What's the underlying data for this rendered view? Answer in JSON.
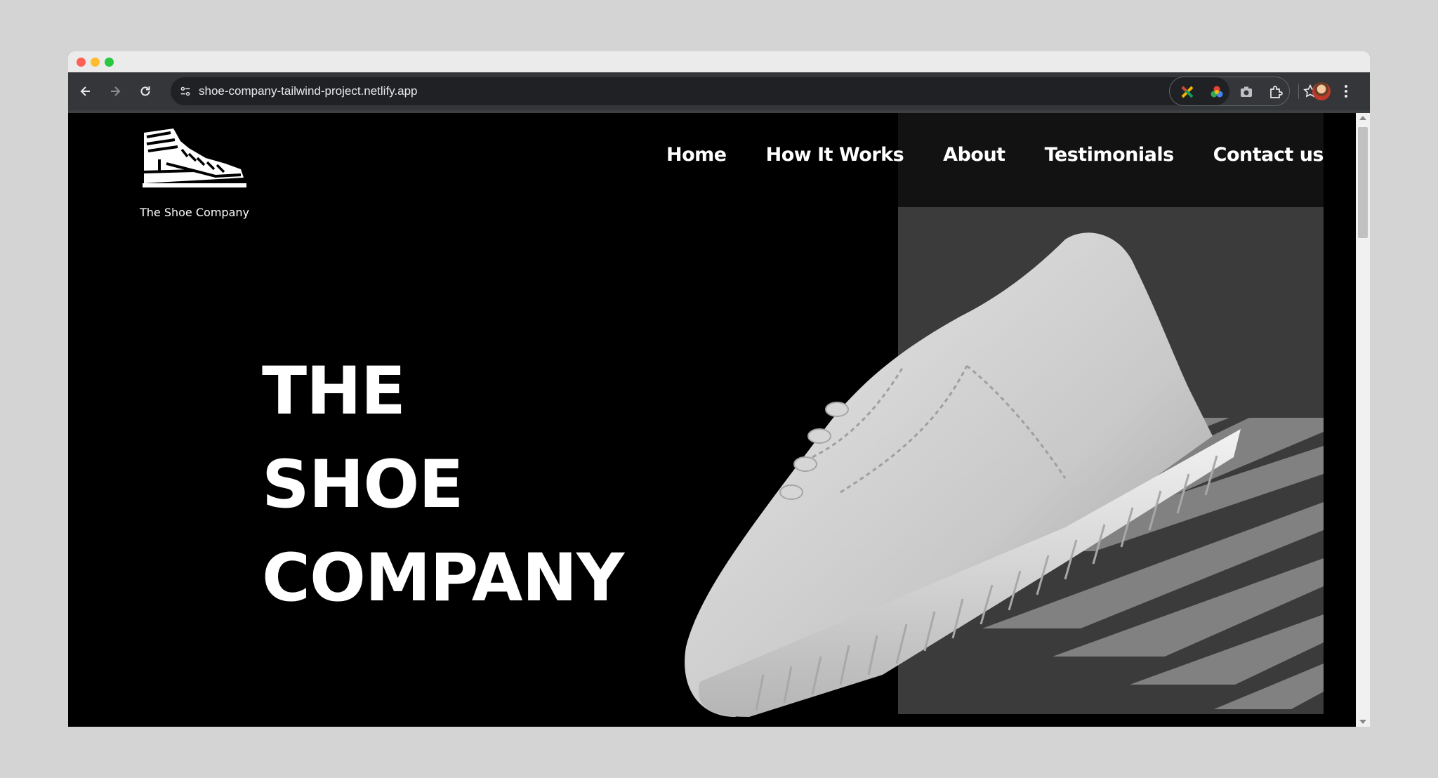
{
  "browser": {
    "url": "shoe-company-tailwind-project.netlify.app",
    "icons": [
      "back-icon",
      "forward-icon",
      "reload-icon",
      "site-info-icon",
      "bookmark-star-icon",
      "extension-icons",
      "puzzle-icon",
      "profile-avatar",
      "more-menu-icon"
    ]
  },
  "site": {
    "logo_text": "The Shoe Company",
    "nav": [
      "Home",
      "How It Works",
      "About",
      "Testimonials",
      "Contact us"
    ],
    "hero": [
      "THE",
      "SHOE",
      "COMPANY"
    ]
  },
  "colors": {
    "background": "#000000",
    "text": "#ffffff",
    "photo": "#3a3a3a"
  }
}
